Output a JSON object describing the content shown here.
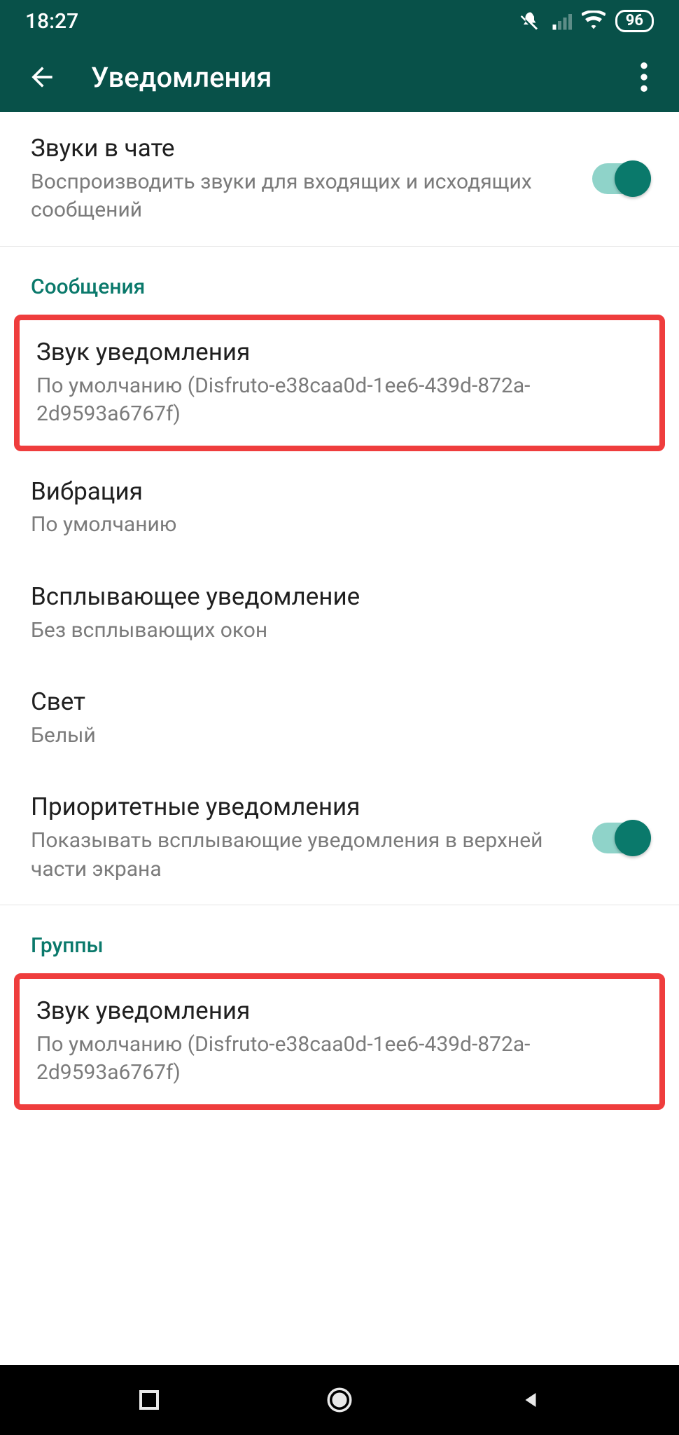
{
  "status": {
    "time": "18:27",
    "battery": "96"
  },
  "header": {
    "title": "Уведомления"
  },
  "chat_sounds": {
    "title": "Звуки в чате",
    "subtitle": "Воспроизводить звуки для входящих и исходящих сообщений"
  },
  "sections": {
    "messages": {
      "header": "Сообщения",
      "notification_sound": {
        "title": "Звук уведомления",
        "subtitle": "По умолчанию (Disfruto-e38caa0d-1ee6-439d-872a-2d9593a6767f)"
      },
      "vibration": {
        "title": "Вибрация",
        "subtitle": "По умолчанию"
      },
      "popup": {
        "title": "Всплывающее уведомление",
        "subtitle": "Без всплывающих окон"
      },
      "light": {
        "title": "Свет",
        "subtitle": "Белый"
      },
      "priority": {
        "title": "Приоритетные уведомления",
        "subtitle": "Показывать всплывающие уведомления в верхней части экрана"
      }
    },
    "groups": {
      "header": "Группы",
      "notification_sound": {
        "title": "Звук уведомления",
        "subtitle": "По умолчанию (Disfruto-e38caa0d-1ee6-439d-872a-2d9593a6767f)"
      }
    }
  }
}
